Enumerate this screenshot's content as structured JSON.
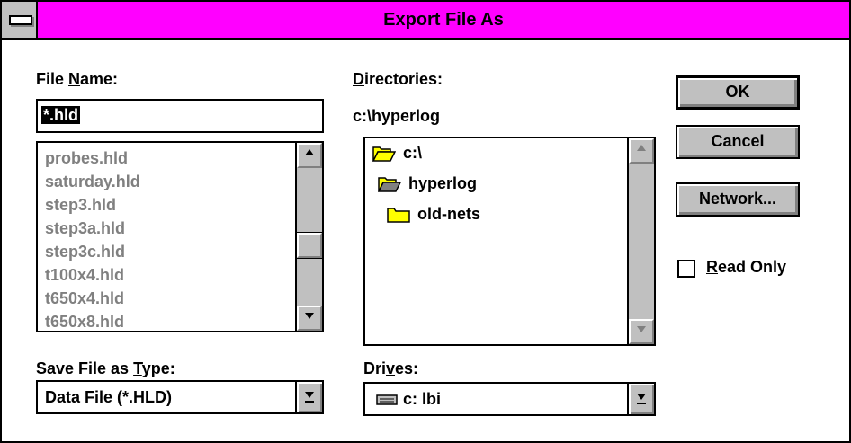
{
  "window": {
    "title": "Export File As"
  },
  "file_name": {
    "label_pre": "File ",
    "label_ul": "N",
    "label_post": "ame:",
    "value": "*.hld",
    "files": [
      "probes.hld",
      "saturday.hld",
      "step3.hld",
      "step3a.hld",
      "step3c.hld",
      "t100x4.hld",
      "t650x4.hld",
      "t650x8.hld"
    ]
  },
  "directories": {
    "label_ul": "D",
    "label_post": "irectories:",
    "current_path": "c:\\hyperlog",
    "items": [
      {
        "name": "c:\\",
        "icon": "open-folder-icon"
      },
      {
        "name": "hyperlog",
        "icon": "open-folder-icon"
      },
      {
        "name": "old-nets",
        "icon": "closed-folder-icon"
      }
    ]
  },
  "buttons": {
    "ok": "OK",
    "cancel": "Cancel",
    "network": "Network..."
  },
  "read_only": {
    "label_ul": "R",
    "label_post": "ead Only",
    "checked": false
  },
  "save_type": {
    "label_pre": "Save File as ",
    "label_ul": "T",
    "label_post": "ype:",
    "value": "Data File (*.HLD)"
  },
  "drives": {
    "label_pre": "Dri",
    "label_ul": "v",
    "label_post": "es:",
    "value": "c: lbi",
    "icon": "hard-drive-icon"
  },
  "colors": {
    "titlebar": "#ff00ff",
    "face": "#c0c0c0",
    "disabled_text": "#808080",
    "folder": "#ffff00"
  }
}
